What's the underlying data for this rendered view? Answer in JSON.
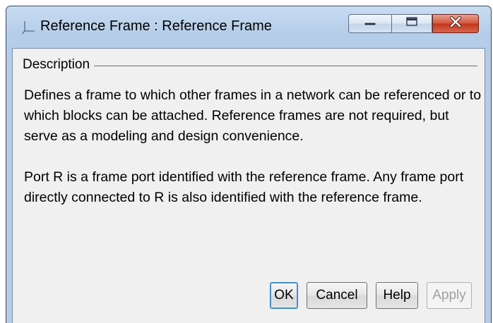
{
  "window": {
    "title": "Reference Frame : Reference Frame",
    "icon": "reference-frame-axes-icon",
    "controls": {
      "minimize": "minimize-icon",
      "maximize": "maximize-icon",
      "close": "close-icon"
    },
    "close_color": "#c7391b"
  },
  "description": {
    "group_label": "Description",
    "paragraphs": [
      "Defines a frame to which other frames in a network can be referenced or to which blocks can be attached. Reference frames are not required, but serve as a modeling and design convenience.",
      "Port R is a frame port identified with the reference frame. Any frame port directly connected to R is also identified with the reference frame."
    ]
  },
  "buttons": {
    "ok": "OK",
    "cancel": "Cancel",
    "help": "Help",
    "apply": "Apply"
  },
  "states": {
    "apply_enabled": false
  }
}
